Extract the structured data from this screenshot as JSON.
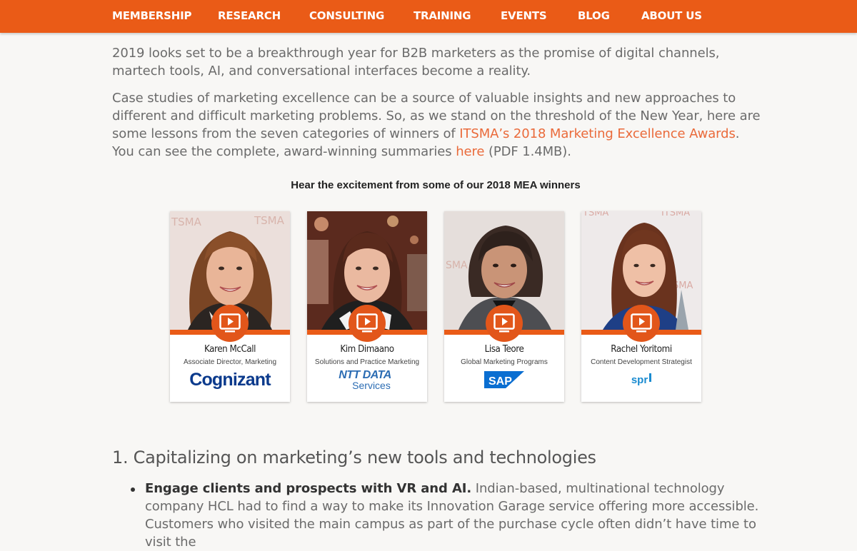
{
  "nav": {
    "items": [
      "MEMBERSHIP",
      "RESEARCH",
      "CONSULTING",
      "TRAINING",
      "EVENTS",
      "BLOG",
      "ABOUT US"
    ]
  },
  "intro": {
    "p1": "2019 looks set to be a breakthrough year for B2B marketers as the promise of digital channels, martech tools, AI, and conversational interfaces become a reality.",
    "p2_start": "Case studies of marketing excellence can be a source of valuable insights and new approaches to different and difficult marketing problems. So, as we stand on the threshold of the New Year, here are some lessons from the seven categories of winners of ",
    "p2_link": "ITSMA’s 2018 Marketing Excellence Awards",
    "p2_mid": ". You can see the complete, award-winning summaries ",
    "p2_link2": "here",
    "p2_end": " (PDF 1.4MB)."
  },
  "videos": {
    "heading": "Hear the excitement from some of our 2018 MEA winners",
    "cards": [
      {
        "name": "Karen McCall",
        "role": "Associate Director, Marketing",
        "company": "Cognizant"
      },
      {
        "name": "Kim Dimaano",
        "role": "Solutions and Practice Marketing",
        "company_line1": "NTT DATA",
        "company_line2": "Services"
      },
      {
        "name": "Lisa Teore",
        "role": "Global Marketing Programs",
        "company": "SAP"
      },
      {
        "name": "Rachel Yoritomi",
        "role": "Content Development Strategist",
        "company": "spr"
      }
    ]
  },
  "section1": {
    "heading": "1. Capitalizing on marketing’s new tools and technologies",
    "bullet_bold": "Engage clients and prospects with VR and AI.",
    "bullet_text": " Indian-based, multinational technology company HCL had to find a way to make its Innovation Garage service offering more accessible. Customers who visited the main campus as part of the purchase cycle often didn’t have time to visit the"
  },
  "colors": {
    "accent": "#ea5b17",
    "link": "#ea6a3a",
    "body_text": "#6b6b6b",
    "page_bg": "#f8f7f5"
  }
}
